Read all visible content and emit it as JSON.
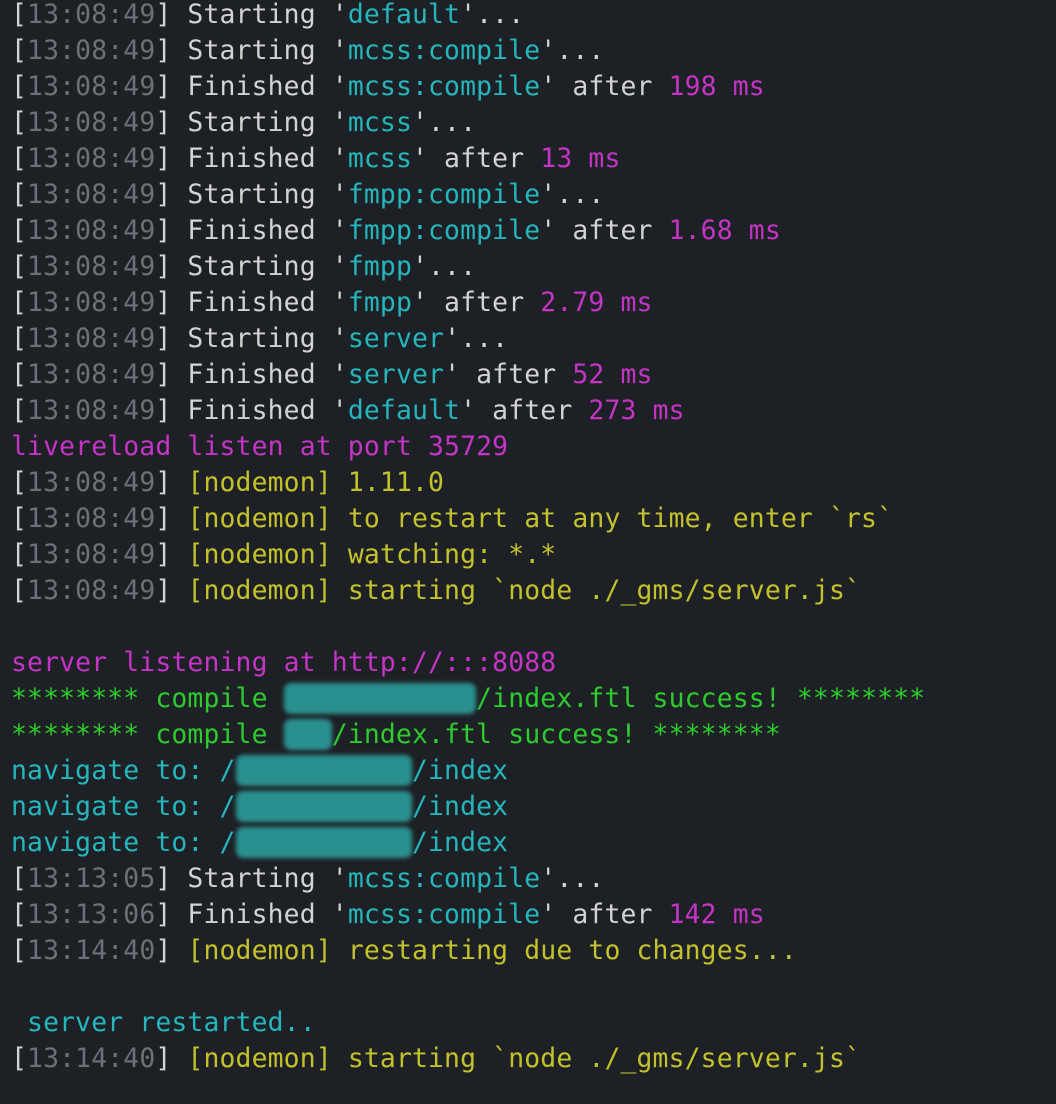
{
  "terminal": {
    "colors": {
      "background": "#1d2125",
      "text": "#d3d3d3",
      "timestamp": "#6c7177",
      "task": "#25b6bd",
      "duration": "#c534c5",
      "nodemon": "#c4c22b",
      "success": "#2ecb2e",
      "redacted": "#2a8f8f"
    },
    "lines": [
      [
        [
          "plain",
          "["
        ],
        [
          "dim",
          "13:08:49"
        ],
        [
          "plain",
          "] Starting '"
        ],
        [
          "cyan",
          "default"
        ],
        [
          "plain",
          "'..."
        ]
      ],
      [
        [
          "plain",
          "["
        ],
        [
          "dim",
          "13:08:49"
        ],
        [
          "plain",
          "] Starting '"
        ],
        [
          "cyan",
          "mcss:compile"
        ],
        [
          "plain",
          "'..."
        ]
      ],
      [
        [
          "plain",
          "["
        ],
        [
          "dim",
          "13:08:49"
        ],
        [
          "plain",
          "] Finished '"
        ],
        [
          "cyan",
          "mcss:compile"
        ],
        [
          "plain",
          "' after "
        ],
        [
          "magenta",
          "198 ms"
        ]
      ],
      [
        [
          "plain",
          "["
        ],
        [
          "dim",
          "13:08:49"
        ],
        [
          "plain",
          "] Starting '"
        ],
        [
          "cyan",
          "mcss"
        ],
        [
          "plain",
          "'..."
        ]
      ],
      [
        [
          "plain",
          "["
        ],
        [
          "dim",
          "13:08:49"
        ],
        [
          "plain",
          "] Finished '"
        ],
        [
          "cyan",
          "mcss"
        ],
        [
          "plain",
          "' after "
        ],
        [
          "magenta",
          "13 ms"
        ]
      ],
      [
        [
          "plain",
          "["
        ],
        [
          "dim",
          "13:08:49"
        ],
        [
          "plain",
          "] Starting '"
        ],
        [
          "cyan",
          "fmpp:compile"
        ],
        [
          "plain",
          "'..."
        ]
      ],
      [
        [
          "plain",
          "["
        ],
        [
          "dim",
          "13:08:49"
        ],
        [
          "plain",
          "] Finished '"
        ],
        [
          "cyan",
          "fmpp:compile"
        ],
        [
          "plain",
          "' after "
        ],
        [
          "magenta",
          "1.68 ms"
        ]
      ],
      [
        [
          "plain",
          "["
        ],
        [
          "dim",
          "13:08:49"
        ],
        [
          "plain",
          "] Starting '"
        ],
        [
          "cyan",
          "fmpp"
        ],
        [
          "plain",
          "'..."
        ]
      ],
      [
        [
          "plain",
          "["
        ],
        [
          "dim",
          "13:08:49"
        ],
        [
          "plain",
          "] Finished '"
        ],
        [
          "cyan",
          "fmpp"
        ],
        [
          "plain",
          "' after "
        ],
        [
          "magenta",
          "2.79 ms"
        ]
      ],
      [
        [
          "plain",
          "["
        ],
        [
          "dim",
          "13:08:49"
        ],
        [
          "plain",
          "] Starting '"
        ],
        [
          "cyan",
          "server"
        ],
        [
          "plain",
          "'..."
        ]
      ],
      [
        [
          "plain",
          "["
        ],
        [
          "dim",
          "13:08:49"
        ],
        [
          "plain",
          "] Finished '"
        ],
        [
          "cyan",
          "server"
        ],
        [
          "plain",
          "' after "
        ],
        [
          "magenta",
          "52 ms"
        ]
      ],
      [
        [
          "plain",
          "["
        ],
        [
          "dim",
          "13:08:49"
        ],
        [
          "plain",
          "] Finished '"
        ],
        [
          "cyan",
          "default"
        ],
        [
          "plain",
          "' after "
        ],
        [
          "magenta",
          "273 ms"
        ]
      ],
      [
        [
          "magenta",
          "livereload listen at port 35729"
        ]
      ],
      [
        [
          "plain",
          "["
        ],
        [
          "dim",
          "13:08:49"
        ],
        [
          "plain",
          "] "
        ],
        [
          "yellow",
          "[nodemon] 1.11.0"
        ]
      ],
      [
        [
          "plain",
          "["
        ],
        [
          "dim",
          "13:08:49"
        ],
        [
          "plain",
          "] "
        ],
        [
          "yellow",
          "[nodemon] to restart at any time, enter `rs`"
        ]
      ],
      [
        [
          "plain",
          "["
        ],
        [
          "dim",
          "13:08:49"
        ],
        [
          "plain",
          "] "
        ],
        [
          "yellow",
          "[nodemon] watching: *.*"
        ]
      ],
      [
        [
          "plain",
          "["
        ],
        [
          "dim",
          "13:08:49"
        ],
        [
          "plain",
          "] "
        ],
        [
          "yellow",
          "[nodemon] starting `node ./_gms/server.js`"
        ]
      ],
      [],
      [
        [
          "magenta",
          "server listening at http://:::8088"
        ]
      ],
      [
        [
          "green",
          "******** compile "
        ],
        [
          "blur",
          "/sharer/fans"
        ],
        [
          "green",
          "/index.ftl success! ********"
        ]
      ],
      [
        [
          "green",
          "******** compile "
        ],
        [
          "blur",
          "/my"
        ],
        [
          "green",
          "/index.ftl success! ********"
        ]
      ],
      [
        [
          "cyan",
          "navigate to: /"
        ],
        [
          "blur",
          "sharer/fans"
        ],
        [
          "cyan",
          "/index"
        ]
      ],
      [
        [
          "cyan",
          "navigate to: /"
        ],
        [
          "blur",
          "sharer/fans"
        ],
        [
          "cyan",
          "/index"
        ]
      ],
      [
        [
          "cyan",
          "navigate to: /"
        ],
        [
          "blur",
          "sharer/fans"
        ],
        [
          "cyan",
          "/index"
        ]
      ],
      [
        [
          "plain",
          "["
        ],
        [
          "dim",
          "13:13:05"
        ],
        [
          "plain",
          "] Starting '"
        ],
        [
          "cyan",
          "mcss:compile"
        ],
        [
          "plain",
          "'..."
        ]
      ],
      [
        [
          "plain",
          "["
        ],
        [
          "dim",
          "13:13:06"
        ],
        [
          "plain",
          "] Finished '"
        ],
        [
          "cyan",
          "mcss:compile"
        ],
        [
          "plain",
          "' after "
        ],
        [
          "magenta",
          "142 ms"
        ]
      ],
      [
        [
          "plain",
          "["
        ],
        [
          "dim",
          "13:14:40"
        ],
        [
          "plain",
          "] "
        ],
        [
          "yellow",
          "[nodemon] restarting due to changes..."
        ]
      ],
      [],
      [
        [
          "cyan",
          " server restarted.."
        ]
      ],
      [
        [
          "plain",
          "["
        ],
        [
          "dim",
          "13:14:40"
        ],
        [
          "plain",
          "] "
        ],
        [
          "yellow",
          "[nodemon] starting `node ./_gms/server.js`"
        ]
      ]
    ]
  }
}
